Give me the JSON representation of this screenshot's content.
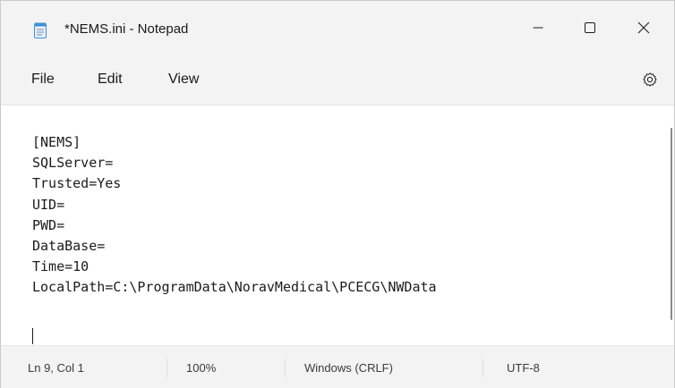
{
  "window": {
    "title": "*NEMS.ini - Notepad",
    "app_icon": "notepad-icon",
    "controls": {
      "minimize": "minimize-icon",
      "maximize": "maximize-icon",
      "close": "close-icon"
    }
  },
  "menu": {
    "items": [
      {
        "label": "File"
      },
      {
        "label": "Edit"
      },
      {
        "label": "View"
      }
    ],
    "settings_icon": "gear-icon"
  },
  "editor": {
    "lines": [
      "[NEMS]",
      "SQLServer=",
      "Trusted=Yes",
      "UID=",
      "PWD=",
      "DataBase=",
      "Time=10",
      "LocalPath=C:\\ProgramData\\NoravMedical\\PCECG\\NWData",
      ""
    ]
  },
  "status": {
    "position": "Ln 9, Col 1",
    "zoom": "100%",
    "line_ending": "Windows (CRLF)",
    "encoding": "UTF-8"
  },
  "colors": {
    "chrome": "#f3f3f3",
    "editor_bg": "#ffffff",
    "text": "#1b1b1b",
    "icon_blue": "#3f8fd8"
  }
}
